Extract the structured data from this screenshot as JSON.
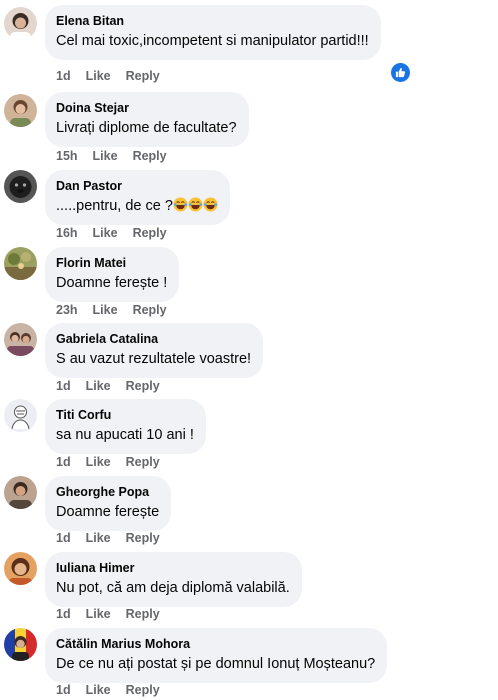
{
  "comments": [
    {
      "name": "Elena Bitan",
      "text": "Cel mai toxic,incompetent si manipulator partid!!!",
      "time": "1d",
      "like": "Like",
      "reply": "Reply",
      "avatar_color": "#d9c8c0",
      "reaction_icon": "like-reaction-icon"
    },
    {
      "name": "Doina Stejar",
      "text": "Livrați diplome de facultate?",
      "time": "15h",
      "like": "Like",
      "reply": "Reply",
      "avatar_color": "#b08a6a"
    },
    {
      "name": "Dan Pastor",
      "text": ".....pentru, de ce ?",
      "time": "16h",
      "like": "Like",
      "reply": "Reply",
      "avatar_color": "#2b2b2b",
      "emoji": [
        "laughing-emoji",
        "laughing-emoji",
        "laughing-emoji"
      ]
    },
    {
      "name": "Florin Matei",
      "text": "Doamne ferește !",
      "time": "23h",
      "like": "Like",
      "reply": "Reply",
      "avatar_color": "#8a8f4a"
    },
    {
      "name": "Gabriela Catalina",
      "text": "S au vazut rezultatele voastre!",
      "time": "1d",
      "like": "Like",
      "reply": "Reply",
      "avatar_color": "#9a6e5a"
    },
    {
      "name": "Titi Corfu",
      "text": "sa nu apucati 10 ani !",
      "time": "1d",
      "like": "Like",
      "reply": "Reply",
      "avatar_color": "#e8e8ee"
    },
    {
      "name": "Gheorghe Popa",
      "text": "Doamne ferește",
      "time": "1d",
      "like": "Like",
      "reply": "Reply",
      "avatar_color": "#7a5a48"
    },
    {
      "name": "Iuliana Himer",
      "text": "Nu pot, că am deja diplomă valabilă.",
      "time": "1d",
      "like": "Like",
      "reply": "Reply",
      "avatar_color": "#c8743a"
    },
    {
      "name": "Cătălin Marius Mohora",
      "text": "De ce nu ați postat și pe domnul Ionuț Moșteanu?",
      "time": "1d",
      "like": "Like",
      "reply": "Reply",
      "avatar_color": "#2a4aa8"
    }
  ],
  "colors": {
    "bubble": "#f0f2f5",
    "meta_text": "#65676b",
    "reaction_blue": "#1b74e4"
  }
}
